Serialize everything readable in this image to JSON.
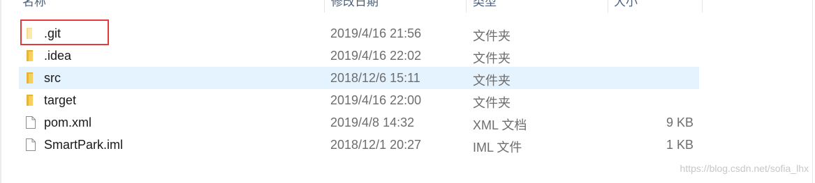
{
  "header": {
    "columns": [
      {
        "label": "名称"
      },
      {
        "label": "修改日期"
      },
      {
        "label": "类型"
      },
      {
        "label": "大小"
      }
    ]
  },
  "files": [
    {
      "name": ".git",
      "date": "2019/4/16 21:56",
      "type": "文件夹",
      "size": "",
      "icon": "folder-icon"
    },
    {
      "name": ".idea",
      "date": "2019/4/16 22:02",
      "type": "文件夹",
      "size": "",
      "icon": "folder-icon"
    },
    {
      "name": "src",
      "date": "2018/12/6 15:11",
      "type": "文件夹",
      "size": "",
      "icon": "folder-icon",
      "selected": true
    },
    {
      "name": "target",
      "date": "2019/4/16 22:00",
      "type": "文件夹",
      "size": "",
      "icon": "folder-icon"
    },
    {
      "name": "pom.xml",
      "date": "2019/4/8 14:32",
      "type": "XML 文档",
      "size": "9 KB",
      "icon": "file-icon"
    },
    {
      "name": "SmartPark.iml",
      "date": "2018/12/1 20:27",
      "type": "IML 文件",
      "size": "1 KB",
      "icon": "file-icon"
    }
  ],
  "watermark": "https://blog.csdn.net/sofia_lhx",
  "colors": {
    "highlight_border": "#e0393e",
    "selected_row": "#e5f3ff",
    "folder": "#f2c94c"
  }
}
